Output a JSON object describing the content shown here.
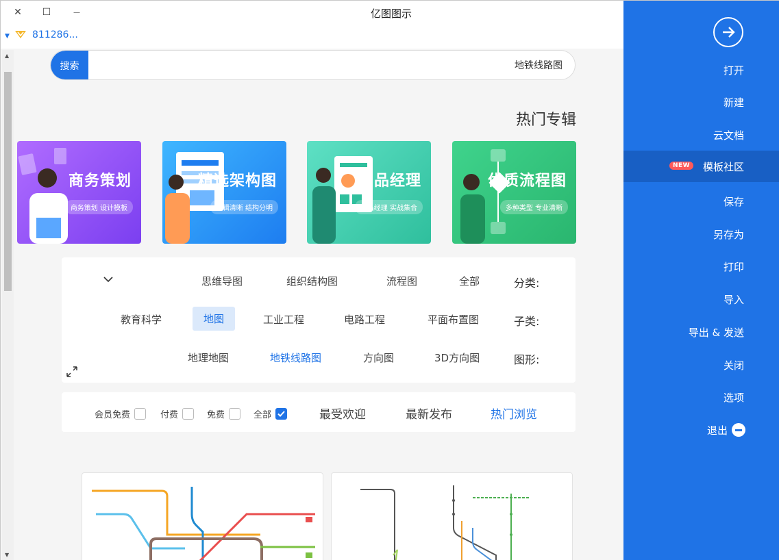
{
  "window": {
    "title": "亿图图示",
    "close_symbol": "✕",
    "max_symbol": "☐",
    "min_symbol": "—"
  },
  "user": {
    "name": "811286...",
    "dropdown_symbol": "▼"
  },
  "sidebar": {
    "items": [
      {
        "label": "打开"
      },
      {
        "label": "新建"
      },
      {
        "label": "云文档"
      },
      {
        "label": "模板社区",
        "badge": "NEW"
      },
      {
        "label": "保存"
      },
      {
        "label": "另存为"
      },
      {
        "label": "打印"
      },
      {
        "label": "导入"
      },
      {
        "label": "导出 & 发送"
      },
      {
        "label": "关闭"
      },
      {
        "label": "选项"
      },
      {
        "label": "退出"
      }
    ]
  },
  "search": {
    "button_label": "搜索",
    "value": "地铁线路图"
  },
  "featured": {
    "title": "热门专辑",
    "banners": [
      {
        "title": "优质流程图",
        "subtitle": "多种类型 专业清晰",
        "color": "#2ec27e"
      },
      {
        "title": "产品经理",
        "subtitle": "产品经理 实战集合",
        "color": "#3fd1b3"
      },
      {
        "title": "精选架构图",
        "subtitle": "逻辑清晰 结构分明",
        "color": "#1d90f0"
      },
      {
        "title": "商务策划",
        "subtitle": "商务策划 设计模板",
        "color": "#8a4df0"
      }
    ]
  },
  "filters": {
    "category": {
      "label": "分类:",
      "options": [
        "全部",
        "流程图",
        "组织结构图",
        "思维导图"
      ]
    },
    "subcategory": {
      "label": "子类:",
      "options": [
        "平面布置图",
        "电路工程",
        "工业工程",
        "地图",
        "教育科学"
      ],
      "selected": "地图"
    },
    "shape": {
      "label": "图形:",
      "options": [
        "3D方向图",
        "方向图",
        "地铁线路图",
        "地理地图"
      ],
      "selected": "地铁线路图"
    }
  },
  "sort": {
    "tabs": [
      "热门浏览",
      "最新发布",
      "最受欢迎"
    ],
    "active": "热门浏览",
    "checkboxes": [
      {
        "label": "全部",
        "checked": true
      },
      {
        "label": "免费",
        "checked": false
      },
      {
        "label": "付费",
        "checked": false
      },
      {
        "label": "会员免费",
        "checked": false
      }
    ]
  },
  "colors": {
    "accent": "#1f73e6",
    "sidebar_active": "#185fc4",
    "badge": "#ff5a5a"
  }
}
